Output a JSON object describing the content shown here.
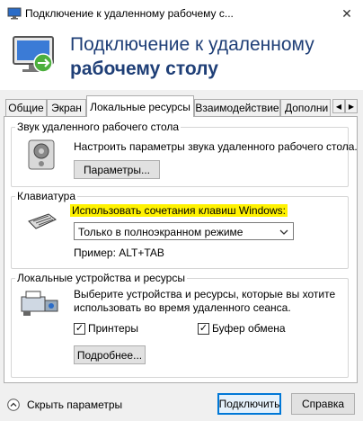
{
  "window": {
    "title": "Подключение к удаленному рабочему с..."
  },
  "header": {
    "line1": "Подключение к удаленному",
    "line2": "рабочему столу"
  },
  "tabs": [
    {
      "label": "Общие"
    },
    {
      "label": "Экран"
    },
    {
      "label": "Локальные ресурсы",
      "active": true
    },
    {
      "label": "Взаимодействие"
    },
    {
      "label": "Дополни"
    }
  ],
  "sound": {
    "legend": "Звук удаленного рабочего стола",
    "description": "Настроить параметры звука удаленного рабочего стола.",
    "button": "Параметры..."
  },
  "keyboard": {
    "legend": "Клавиатура",
    "label": "Использовать сочетания клавиш Windows:",
    "selected": "Только в полноэкранном режиме",
    "example": "Пример: ALT+TAB"
  },
  "devices": {
    "legend": "Локальные устройства и ресурсы",
    "description_line1": "Выберите устройства и ресурсы, которые вы хотите",
    "description_line2": "использовать во время удаленного сеанса.",
    "printers": {
      "label": "Принтеры",
      "checked": true
    },
    "clipboard": {
      "label": "Буфер обмена",
      "checked": true
    },
    "more_button": "Подробнее..."
  },
  "footer": {
    "hide_options": "Скрыть параметры",
    "connect_button": "Подключить",
    "help_button": "Справка"
  },
  "colors": {
    "accent": "#0078d7",
    "header_text": "#1f3f77",
    "highlight": "#fff200"
  }
}
